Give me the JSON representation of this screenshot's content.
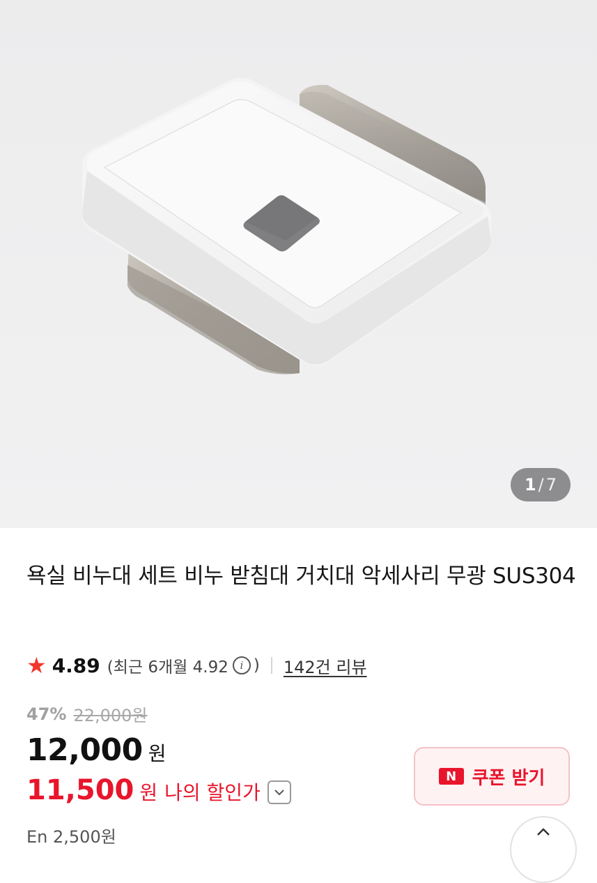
{
  "gallery": {
    "current": "1",
    "separator": "/",
    "total": "7"
  },
  "product": {
    "title": "욕실 비누대 세트 비누 받침대 거치대 악세사리 무광 SUS304",
    "rating": "4.89",
    "recent_rating_text": "(최근 6개월 4.92",
    "recent_close": ")",
    "review_link": "142건 리뷰"
  },
  "pricing": {
    "discount_percent": "47%",
    "original_price": "22,000원",
    "price": "12,000",
    "price_unit": "원",
    "my_price": "11,500",
    "my_price_unit": "원",
    "my_price_label": "나의 할인가",
    "partial_text": "En 2,500원"
  },
  "coupon": {
    "logo": "N",
    "label": "쿠폰 받기"
  },
  "colors": {
    "accent_red": "#e8152c",
    "star": "#f2362b"
  },
  "icons": {
    "star": "star-icon",
    "info": "info-icon",
    "chevron": "chevron-down-icon",
    "coupon_logo": "naver-n-icon"
  }
}
